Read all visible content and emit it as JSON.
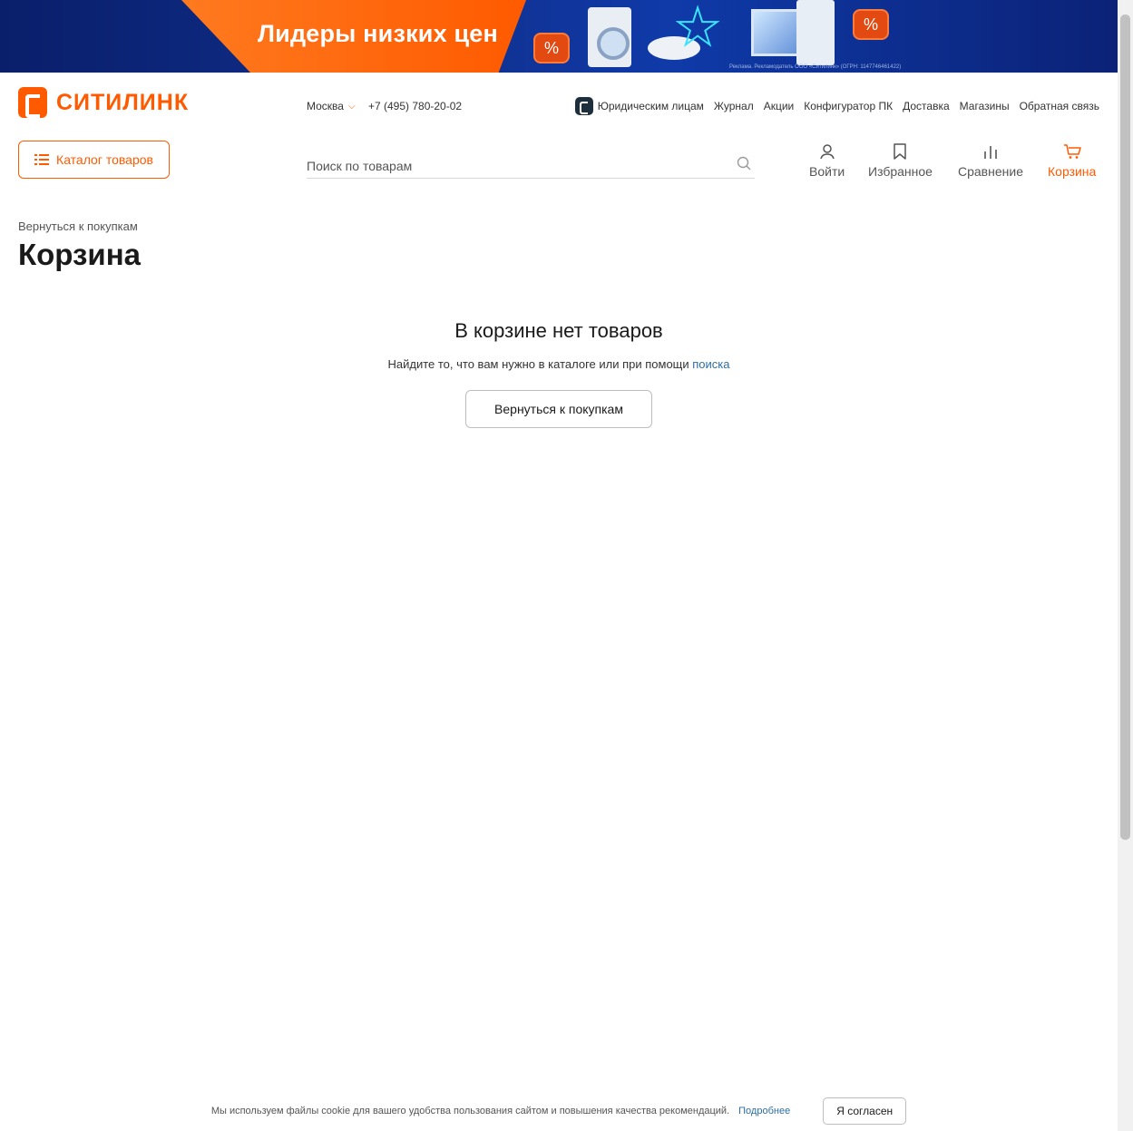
{
  "banner": {
    "headline": "Лидеры низких цен",
    "percent_symbol": "%",
    "disclaimer": "Реклама. Рекламодатель ООО «Ситилинк» (ОГРН: 1147746461422)"
  },
  "header": {
    "logo_text": "СИТИЛИНК",
    "city": "Москва",
    "phone": "+7 (495) 780-20-02",
    "top_nav": [
      "Юридическим лицам",
      "Журнал",
      "Акции",
      "Конфигуратор ПК",
      "Доставка",
      "Магазины",
      "Обратная связь"
    ],
    "catalog_button": "Каталог товаров",
    "search_placeholder": "Поиск по товарам",
    "actions": {
      "login": "Войти",
      "favorites": "Избранное",
      "compare": "Сравнение",
      "cart": "Корзина"
    }
  },
  "main": {
    "back_link": "Вернуться к покупкам",
    "title": "Корзина",
    "empty_title": "В корзине нет товаров",
    "empty_hint_prefix": "Найдите то, что вам нужно в каталоге или при помощи",
    "empty_hint_link": "поиска",
    "return_button": "Вернуться к покупкам"
  },
  "cookie": {
    "text": "Мы используем файлы cookie для вашего удобства пользования сайтом и повышения качества рекомендаций.",
    "more_link": "Подробнее",
    "accept_button": "Я согласен"
  },
  "colors": {
    "brand": "#ff5a00",
    "link": "#2e6da4"
  }
}
